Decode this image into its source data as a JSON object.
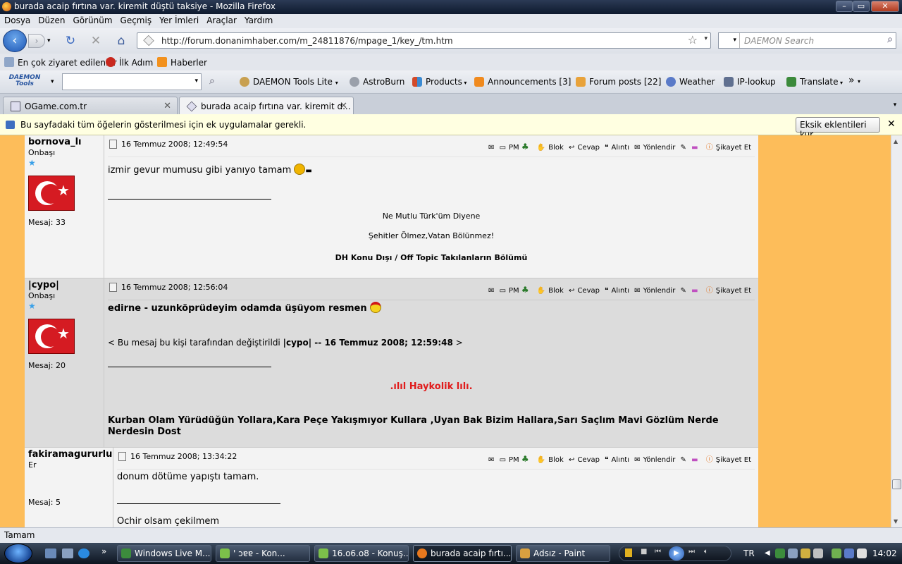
{
  "window": {
    "title": "burada acaip fırtına var. kiremit düştü taksiye - Mozilla Firefox"
  },
  "menu": [
    "Dosya",
    "Düzen",
    "Görünüm",
    "Geçmiş",
    "Yer İmleri",
    "Araçlar",
    "Yardım"
  ],
  "navigation": {
    "url": "http://forum.donanimhaber.com/m_24811876/mpage_1/key_/tm.htm",
    "search_placeholder": "DAEMON Search"
  },
  "bookmarks": [
    {
      "label": "En çok ziyaret edilenler",
      "icon": "gear-icon"
    },
    {
      "label": "İlk Adım",
      "icon": "firefox-icon"
    },
    {
      "label": "Haberler",
      "icon": "rss-icon"
    }
  ],
  "daemon_toolbar": {
    "logo_line1": "DAEMON",
    "logo_line2": "Tools",
    "items": [
      {
        "label": "DAEMON Tools Lite",
        "color": "#c8a050"
      },
      {
        "label": "AstroBurn",
        "color": "#9aa0aa"
      },
      {
        "label": "Products",
        "color": "#d24a2a"
      },
      {
        "label": "Announcements [3]",
        "color": "#f08a1e"
      },
      {
        "label": "Forum posts [22]",
        "color": "#e8a23a"
      },
      {
        "label": "Weather",
        "color": "#5a7ac8"
      },
      {
        "label": "IP-lookup",
        "color": "#607090"
      },
      {
        "label": "Translate",
        "color": "#3b8a3b"
      }
    ]
  },
  "tabs": [
    {
      "label": "OGame.com.tr",
      "active": false
    },
    {
      "label": "burada acaip fırtına var. kiremit d...",
      "active": true
    }
  ],
  "infobar": {
    "message": "Bu sayfadaki tüm öğelerin gösterilmesi için ek uygulamalar gerekli.",
    "button": "Eksik eklentileri kur..."
  },
  "post_actions": [
    "PM",
    "Blok",
    "Cevap",
    "Alıntı",
    "Yönlendir",
    "Şikayet Et"
  ],
  "posts": [
    {
      "user": "bornova_lı",
      "rank": "Onbaşı",
      "message_count": "Mesaj: 33",
      "date": "16 Temmuz 2008; 12:49:54",
      "text": "izmir gevur mumusu gibi yanıyo tamam",
      "signature": [
        "Ne Mutlu Türk'üm Diyene",
        "Şehitler Ölmez,Vatan Bölünmez!",
        "DH Konu Dışı / Off Topic Takılanların Bölümü"
      ]
    },
    {
      "user": "|cypo|",
      "rank": "Onbaşı",
      "message_count": "Mesaj: 20",
      "date": "16 Temmuz 2008; 12:56:04",
      "text": "edirne - uzunköprüdeyim odamda üşüyom resmen",
      "edit_prefix": "< Bu mesaj bu kişi tarafından değiştirildi",
      "edit_info": "|cypo| -- 16 Temmuz 2008; 12:59:48",
      "edit_suffix": ">",
      "sig_title": ".ılıl Haykolik lılı.",
      "sig_text": "Kurban Olam Yürüdüğün Yollara,Kara Peçe Yakışmıyor Kullara ,Uyan Bak Bizim Hallara,Sarı Saçlım Mavi Gözlüm Nerde Nerdesin Dost"
    },
    {
      "user": "fakiramagururlu",
      "rank": "Er",
      "message_count": "Mesaj: 5",
      "date": "16 Temmuz 2008; 13:34:22",
      "text": "donum dötüme yapıştı tamam.",
      "sig_partial": "Ochir olsam çekilmem"
    }
  ],
  "status": "Tamam",
  "taskbar": {
    "items": [
      {
        "label": "Windows Live M...",
        "color": "#3c8c3c"
      },
      {
        "label": "' ɔɐɐ - Kon...",
        "color": "#7cc04a"
      },
      {
        "label": "16.o6.o8 - Konuş...",
        "color": "#7cc04a"
      },
      {
        "label": "burada acaip fırtı...",
        "color": "#e8781e"
      },
      {
        "label": "Adsız - Paint",
        "color": "#d8a040"
      }
    ],
    "language": "TR",
    "clock": "14:02"
  },
  "colors": {
    "page_bg": "#fdbd5a",
    "sig_title_red": "#e01b1b",
    "post_alt_bg": "#dcdcdc"
  }
}
